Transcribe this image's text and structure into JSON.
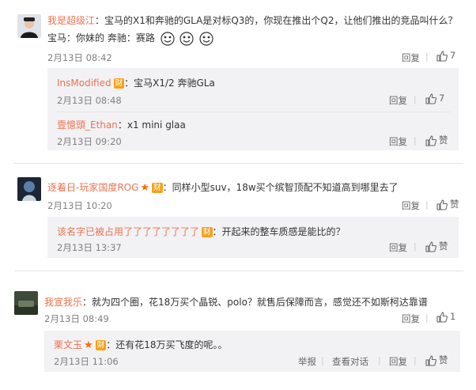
{
  "comments": [
    {
      "user": "我是超级江",
      "text": "：宝马的X1和奔驰的GLA是对标Q3的，你现在推出个Q2，让他们推出的竞品叫什么？",
      "text2": "宝马：你妹的 奔驰：赛路",
      "time": "2月13日 08:42",
      "reply_label": "回复",
      "likes": "7",
      "replies": [
        {
          "user": "InsModified",
          "badge": "财",
          "text": "：宝马X1/2 奔驰GLa",
          "time": "2月13日 08:48",
          "reply_label": "回复",
          "likes": "7"
        },
        {
          "user": "壹憶頭_Ethan",
          "text": "：x1 mini glaa",
          "time": "2月13日 09:20",
          "reply_label": "回复",
          "likes": "赞"
        }
      ]
    },
    {
      "user": "逐着日-玩家国度ROG",
      "badge": "财",
      "text": "：同样小型suv，18w买个缤智顶配不知道高到哪里去了",
      "time": "2月13日 10:20",
      "reply_label": "回复",
      "likes": "赞",
      "replies": [
        {
          "user": "该名字已被占用了了了了了了了了",
          "badge": "财",
          "text": "：开起来的整车质感是能比的？",
          "time": "2月13日 13:37",
          "reply_label": "回复",
          "likes": "赞"
        }
      ]
    },
    {
      "user": "我宣我乐",
      "text": "：就为四个圈，花18万买个晶锐、polo？就售后保障而言，感觉还不如斯柯达靠谱",
      "time": "2月13日 08:49",
      "reply_label": "回复",
      "likes": "1",
      "replies": [
        {
          "user": "栗文玉",
          "badge": "财",
          "text": "：还有花18万买飞度的呢。。",
          "time": "2月13日 11:06",
          "report_label": "举报",
          "view_label": "查看对话",
          "reply_label": "回复",
          "likes": "赞"
        }
      ]
    }
  ],
  "colors": {
    "username": "#eb7350",
    "reply_bg": "#f2f2f5",
    "badge": "#f7a21b"
  },
  "icons": [
    "thumb-up-icon",
    "vip-badge-icon",
    "star-icon",
    "emoji-icon"
  ]
}
